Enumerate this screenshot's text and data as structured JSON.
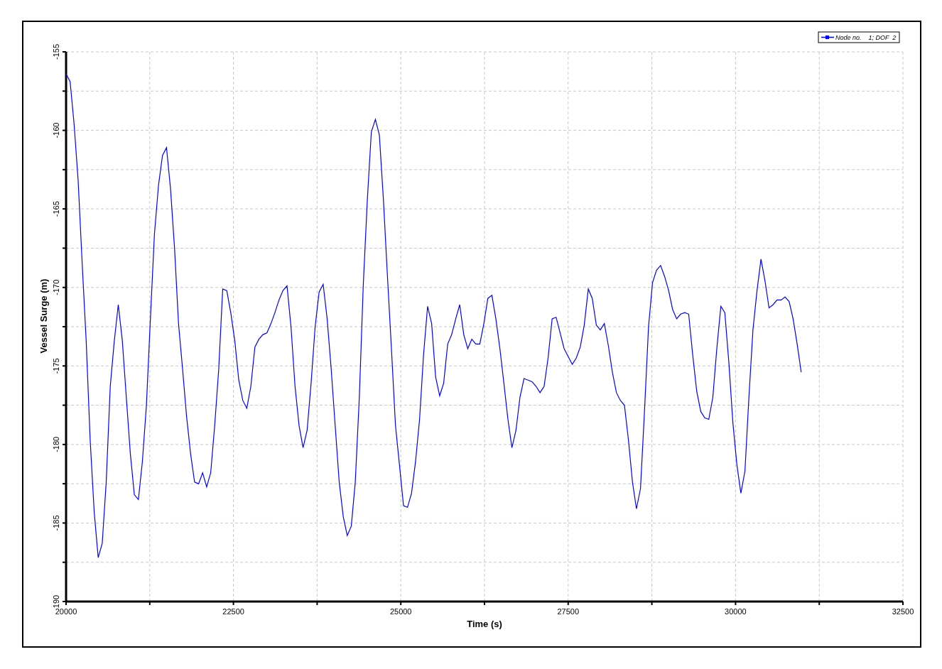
{
  "chart": {
    "chart_data": {
      "type": "line",
      "grid": true,
      "xlabel": "Time (s)",
      "ylabel": "Vessel Surge (m)",
      "xlim": [
        20000,
        32500
      ],
      "ylim": [
        -190,
        -155
      ],
      "xticks": [
        20000,
        22500,
        25000,
        27500,
        30000,
        32500
      ],
      "yticks": [
        -155,
        -160,
        -165,
        -170,
        -175,
        -180,
        -185,
        {
          "value": -190,
          "label": "190"
        }
      ],
      "x": [
        20000,
        20060,
        20120,
        20180,
        20240,
        20300,
        20360,
        20420,
        20480,
        20540,
        20600,
        20660,
        20720,
        20780,
        20840,
        20900,
        20960,
        21020,
        21080,
        21140,
        21200,
        21260,
        21320,
        21380,
        21440,
        21500,
        21560,
        21620,
        21680,
        21740,
        21800,
        21860,
        21920,
        21980,
        22040,
        22100,
        22160,
        22220,
        22280,
        22340,
        22400,
        22460,
        22520,
        22580,
        22640,
        22700,
        22760,
        22820,
        22880,
        22940,
        23000,
        23060,
        23120,
        23180,
        23240,
        23300,
        23360,
        23420,
        23480,
        23540,
        23600,
        23660,
        23720,
        23780,
        23840,
        23900,
        23960,
        24020,
        24080,
        24140,
        24200,
        24260,
        24320,
        24380,
        24440,
        24500,
        24560,
        24620,
        24680,
        24740,
        24800,
        24860,
        24920,
        24980,
        25040,
        25100,
        25160,
        25220,
        25280,
        25340,
        25400,
        25460,
        25520,
        25580,
        25640,
        25700,
        25760,
        25820,
        25880,
        25940,
        26000,
        26060,
        26120,
        26180,
        26240,
        26300,
        26360,
        26420,
        26480,
        26540,
        26600,
        26660,
        26720,
        26780,
        26840,
        26900,
        26960,
        27020,
        27080,
        27140,
        27200,
        27260,
        27320,
        27380,
        27440,
        27500,
        27560,
        27620,
        27680,
        27740,
        27800,
        27860,
        27920,
        27980,
        28040,
        28100,
        28160,
        28220,
        28280,
        28340,
        28400,
        28460,
        28520,
        28580,
        28640,
        28700,
        28760,
        28820,
        28880,
        28940,
        29000,
        29060,
        29120,
        29180,
        29240,
        29300,
        29360,
        29420,
        29480,
        29540,
        29600,
        29660,
        29720,
        29780,
        29840,
        29900,
        29960,
        30020,
        30080,
        30140,
        30200,
        30260,
        30320,
        30380,
        30440,
        30500,
        30560,
        30620,
        30680,
        30740,
        30800,
        30860,
        30920,
        30980
      ],
      "series": [
        {
          "name": "Node no.    1; DOF  2",
          "color": "#0000ff",
          "values": [
            -156.4,
            -156.9,
            -159.6,
            -163.2,
            -168.4,
            -173.4,
            -179.7,
            -184.3,
            -187.2,
            -186.3,
            -182.4,
            -176.3,
            -173.4,
            -171.1,
            -173.4,
            -177.0,
            -180.6,
            -183.2,
            -183.5,
            -181.1,
            -177.5,
            -172.0,
            -166.6,
            -163.5,
            -161.6,
            -161.1,
            -163.7,
            -167.5,
            -172.3,
            -175.2,
            -178.2,
            -180.6,
            -182.4,
            -182.5,
            -181.8,
            -182.7,
            -181.8,
            -178.8,
            -175.2,
            -170.1,
            -170.2,
            -171.6,
            -173.4,
            -175.9,
            -177.2,
            -177.7,
            -176.3,
            -173.8,
            -173.3,
            -173.0,
            -172.9,
            -172.3,
            -171.6,
            -170.8,
            -170.2,
            -169.9,
            -172.5,
            -176.3,
            -178.8,
            -180.2,
            -179.1,
            -176.1,
            -172.5,
            -170.3,
            -169.8,
            -172.0,
            -175.2,
            -178.8,
            -182.4,
            -184.6,
            -185.8,
            -185.2,
            -182.4,
            -177.0,
            -169.8,
            -164.4,
            -160.1,
            -159.3,
            -160.3,
            -164.4,
            -169.3,
            -173.9,
            -178.8,
            -181.3,
            -183.9,
            -184.0,
            -183.1,
            -181.1,
            -178.4,
            -174.3,
            -171.2,
            -172.3,
            -175.7,
            -176.9,
            -176.1,
            -173.6,
            -173.0,
            -172.0,
            -171.1,
            -173.0,
            -173.9,
            -173.3,
            -173.6,
            -173.6,
            -172.3,
            -170.7,
            -170.5,
            -172.0,
            -173.9,
            -176.1,
            -178.4,
            -180.2,
            -179.1,
            -177.0,
            -175.8,
            -175.9,
            -176.0,
            -176.3,
            -176.7,
            -176.3,
            -174.5,
            -172.0,
            -171.9,
            -172.9,
            -173.9,
            -174.4,
            -174.9,
            -174.5,
            -173.8,
            -172.4,
            -170.1,
            -170.7,
            -172.4,
            -172.7,
            -172.3,
            -173.7,
            -175.4,
            -176.7,
            -177.2,
            -177.5,
            -179.7,
            -182.4,
            -184.1,
            -182.8,
            -177.9,
            -172.5,
            -169.7,
            -168.9,
            -168.6,
            -169.3,
            -170.2,
            -171.4,
            -172.0,
            -171.7,
            -171.6,
            -171.7,
            -174.3,
            -176.6,
            -177.9,
            -178.3,
            -178.4,
            -177.0,
            -173.9,
            -171.2,
            -171.6,
            -174.8,
            -178.6,
            -181.3,
            -183.1,
            -181.7,
            -177.0,
            -172.7,
            -170.2,
            -168.2,
            -169.6,
            -171.3,
            -171.1,
            -170.8,
            -170.8,
            -170.6,
            -170.9,
            -172.0,
            -173.6,
            -175.4
          ]
        }
      ]
    }
  }
}
